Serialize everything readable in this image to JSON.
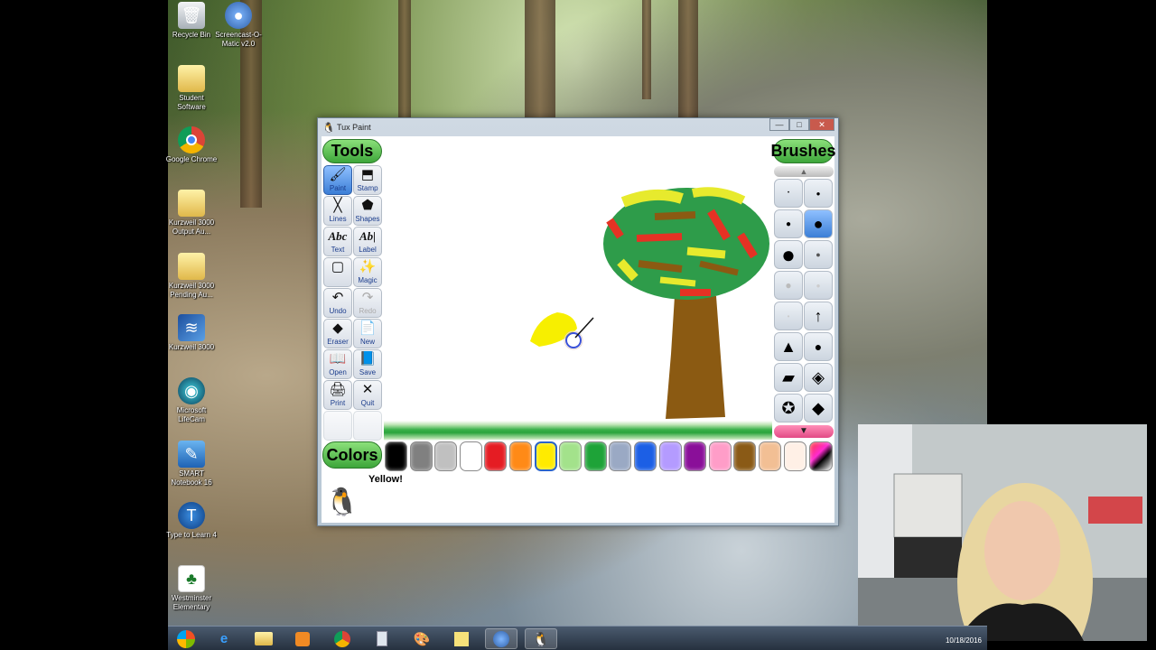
{
  "desktop": {
    "icons": [
      {
        "label": "Recycle Bin",
        "icon": "recycle-bin-icon"
      },
      {
        "label": "Screencast-O-Matic v2.0",
        "icon": "screencast-icon"
      },
      {
        "label": "Student Software",
        "icon": "folder-icon"
      },
      {
        "label": "Google Chrome",
        "icon": "chrome-icon"
      },
      {
        "label": "Kurzweil 3000 Output Au...",
        "icon": "folder-icon"
      },
      {
        "label": "Kurzweil 3000 Pending Au...",
        "icon": "folder-icon"
      },
      {
        "label": "Kurzweil 3000",
        "icon": "kurzweil-icon"
      },
      {
        "label": "Microsoft LifeCam",
        "icon": "lifecam-icon"
      },
      {
        "label": "SMART Notebook 16",
        "icon": "smart-notebook-icon"
      },
      {
        "label": "Type to Learn 4",
        "icon": "type-to-learn-icon"
      },
      {
        "label": "Westminster Elementary",
        "icon": "school-icon"
      }
    ]
  },
  "window": {
    "title": "Tux Paint",
    "controls": {
      "minimize": "—",
      "maximize": "□",
      "close": "✕"
    }
  },
  "tools": {
    "label": "Tools",
    "items": [
      {
        "label": "Paint",
        "selected": true
      },
      {
        "label": "Stamp"
      },
      {
        "label": "Lines"
      },
      {
        "label": "Shapes"
      },
      {
        "label": "Text"
      },
      {
        "label": "Label"
      },
      {
        "label": ""
      },
      {
        "label": "Magic"
      },
      {
        "label": "Undo"
      },
      {
        "label": "Redo",
        "disabled": true
      },
      {
        "label": "Eraser"
      },
      {
        "label": "New"
      },
      {
        "label": "Open"
      },
      {
        "label": "Save"
      },
      {
        "label": "Print"
      },
      {
        "label": "Quit"
      }
    ]
  },
  "brushes": {
    "label": "Brushes",
    "selected_index": 3
  },
  "colors": {
    "label": "Colors",
    "swatches": [
      "#000000",
      "#808080",
      "#c0c0c0",
      "#ffffff",
      "#e51c23",
      "#ff8a17",
      "#ffeb00",
      "#a3e28b",
      "#1ea338",
      "#9aa9c4",
      "#1c5fe5",
      "#b49bff",
      "#8a0f99",
      "#ff9dc8",
      "#8a5a16",
      "#f2bf94",
      "#fff0e6"
    ],
    "selected_index": 6
  },
  "status": {
    "message": "Yellow!"
  },
  "taskbar": {
    "clock": "10/18/2016"
  }
}
